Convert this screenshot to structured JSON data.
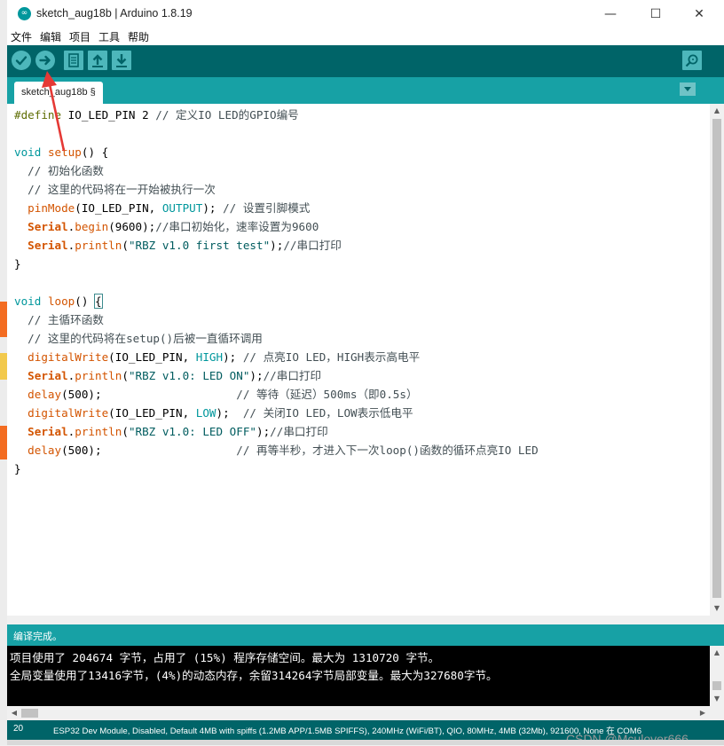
{
  "window": {
    "title": "sketch_aug18b | Arduino 1.8.19",
    "app_icon_glyph": "∞"
  },
  "window_controls": {
    "minimize": "—",
    "maximize": "☐",
    "close": "✕"
  },
  "menu": [
    "文件",
    "编辑",
    "项目",
    "工具",
    "帮助"
  ],
  "toolbar": {
    "verify": "checkmark-icon",
    "upload": "arrow-right-icon",
    "new": "new-file-icon",
    "open": "arrow-up-icon",
    "save": "arrow-down-icon",
    "serial_monitor": "magnifier-icon"
  },
  "tab": {
    "label": "sketch_aug18b §"
  },
  "code": [
    "#define IO_LED_PIN 2 // 定义IO LED的GPIO编号",
    "",
    "void setup() {",
    "  // 初始化函数",
    "  // 这里的代码将在一开始被执行一次",
    "  pinMode(IO_LED_PIN, OUTPUT); // 设置引脚模式",
    "  Serial.begin(9600);//串口初始化，速率设置为9600",
    "  Serial.println(\"RBZ v1.0 first test\");//串口打印",
    "}",
    "",
    "void loop() {",
    "  // 主循环函数",
    "  // 这里的代码将在setup()后被一直循环调用",
    "  digitalWrite(IO_LED_PIN, HIGH); // 点亮IO LED，HIGH表示高电平",
    "  Serial.println(\"RBZ v1.0: LED ON\");//串口打印",
    "  delay(500);                    // 等待（延迟）500ms（即0.5s）",
    "  digitalWrite(IO_LED_PIN, LOW);  // 关闭IO LED，LOW表示低电平",
    "  Serial.println(\"RBZ v1.0: LED OFF\");//串口打印",
    "  delay(500);                    // 再等半秒，才进入下一次loop()函数的循环点亮IO LED",
    "}"
  ],
  "status": {
    "message": "编译完成。"
  },
  "console": [
    "项目使用了 204674 字节，占用了 (15%) 程序存储空间。最大为 1310720 字节。",
    "全局变量使用了13416字节，(4%)的动态内存，余留314264字节局部变量。最大为327680字节。"
  ],
  "footer": {
    "line_number": "20",
    "board": "ESP32 Dev Module, Disabled, Default 4MB with spiffs (1.2MB APP/1.5MB SPIFFS), 240MHz (WiFi/BT), QIO, 80MHz, 4MB (32Mb), 921600, None 在 COM6"
  },
  "watermark": "CSDN @Mculover666",
  "colors": {
    "toolbar": "#006468",
    "tabbar": "#17a1a5",
    "button": "#4db7bb",
    "annotation_arrow": "#e53935"
  }
}
